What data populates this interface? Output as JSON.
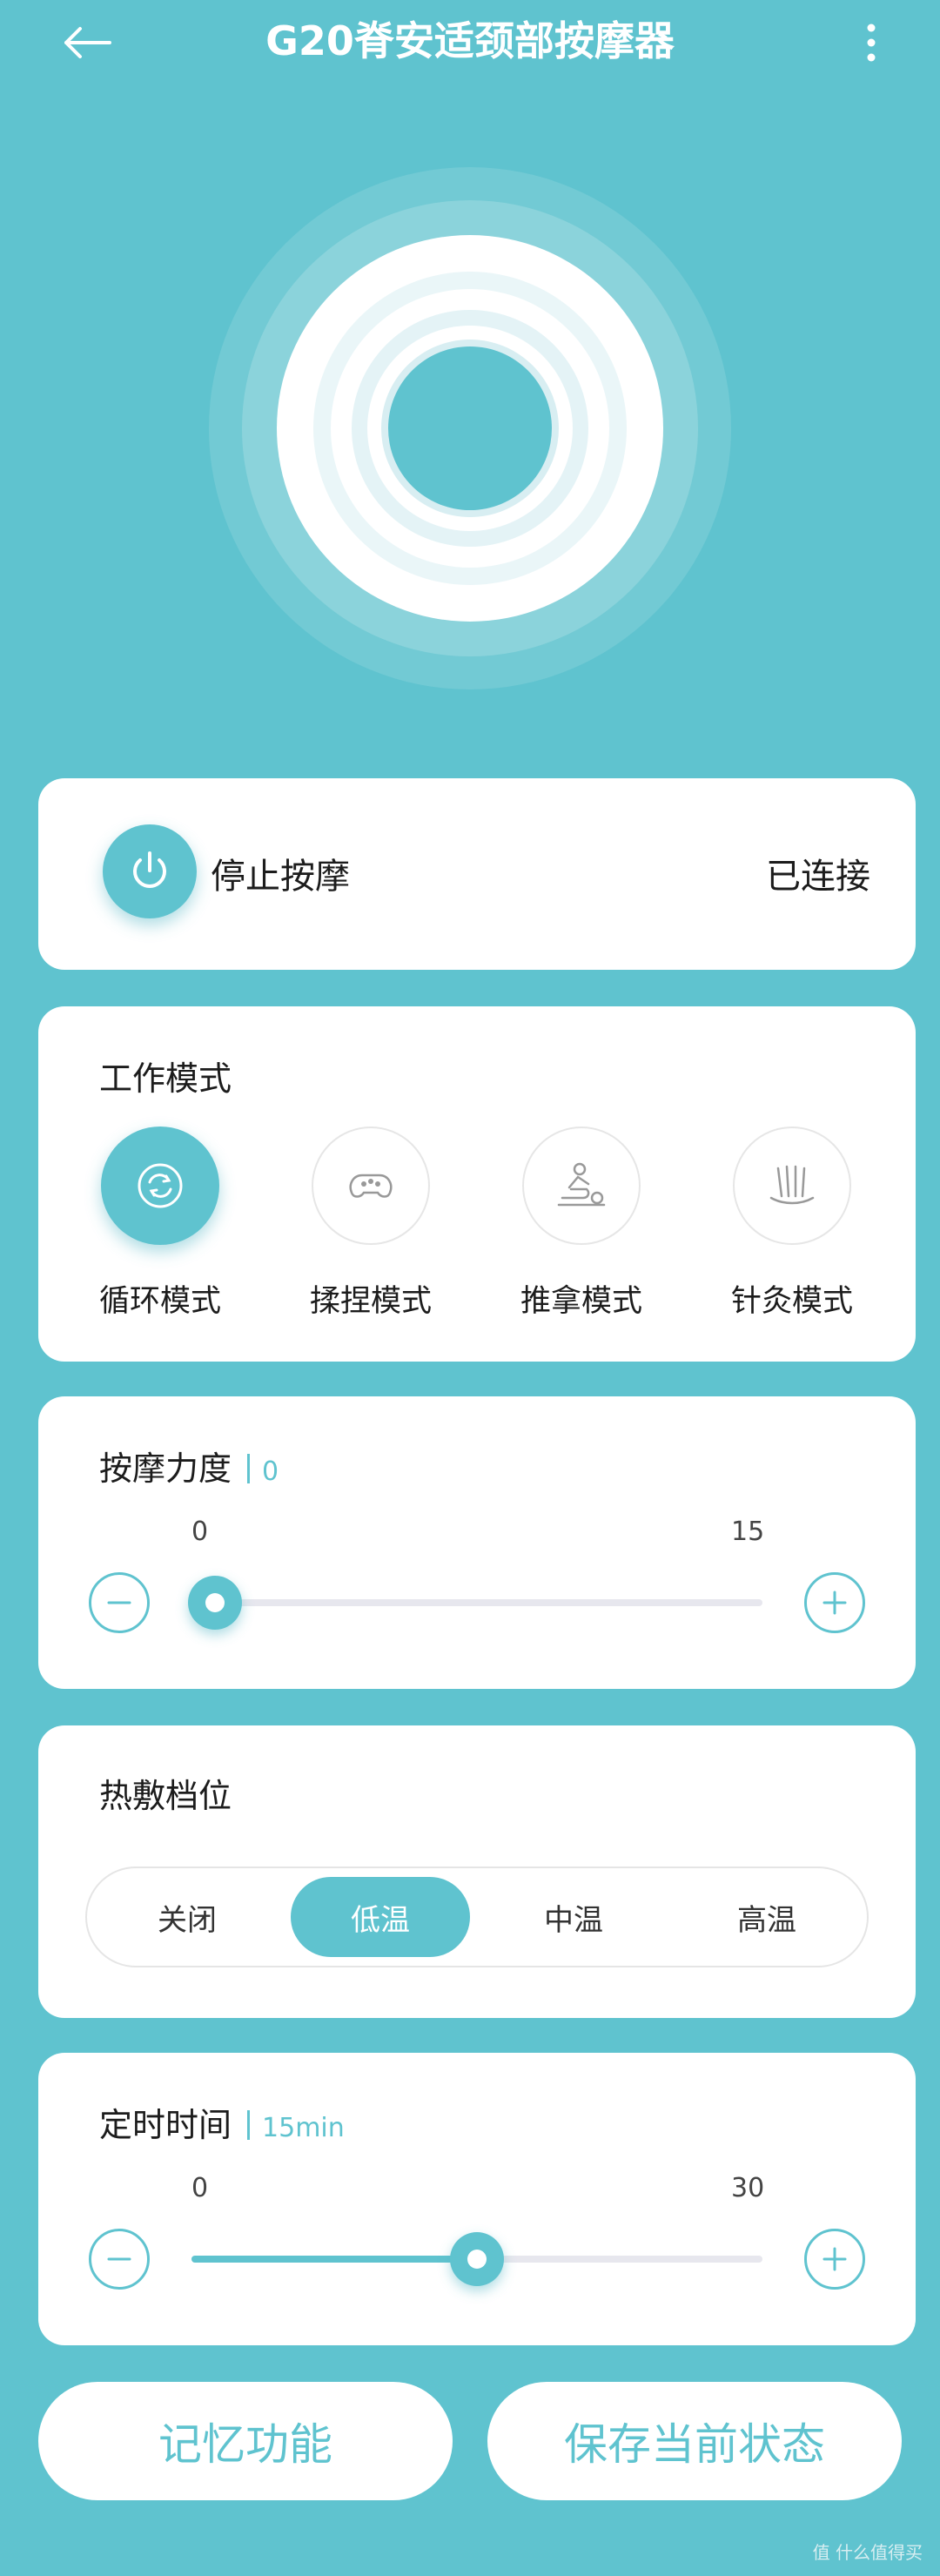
{
  "header": {
    "title": "G20脊安适颈部按摩器"
  },
  "power": {
    "label": "停止按摩",
    "connection_status": "已连接"
  },
  "modes": {
    "title": "工作模式",
    "items": [
      {
        "label": "循环模式",
        "icon": "cycle-icon",
        "active": true
      },
      {
        "label": "揉捏模式",
        "icon": "knead-icon",
        "active": false
      },
      {
        "label": "推拿模式",
        "icon": "massage-icon",
        "active": false
      },
      {
        "label": "针灸模式",
        "icon": "acupuncture-icon",
        "active": false
      }
    ]
  },
  "intensity": {
    "title": "按摩力度",
    "value": "0",
    "min_label": "0",
    "max_label": "15",
    "fraction": 0
  },
  "heat": {
    "title": "热敷档位",
    "options": [
      "关闭",
      "低温",
      "中温",
      "高温"
    ],
    "selected": "低温"
  },
  "timer": {
    "title": "定时时间",
    "value": "15min",
    "min_label": "0",
    "max_label": "30",
    "fraction": 0.5
  },
  "buttons": {
    "memory": "记忆功能",
    "save_state": "保存当前状态"
  },
  "watermark": "值 什么值得买",
  "colors": {
    "accent": "#5fc3cf",
    "background": "#5fc3cf",
    "card": "#ffffff"
  }
}
